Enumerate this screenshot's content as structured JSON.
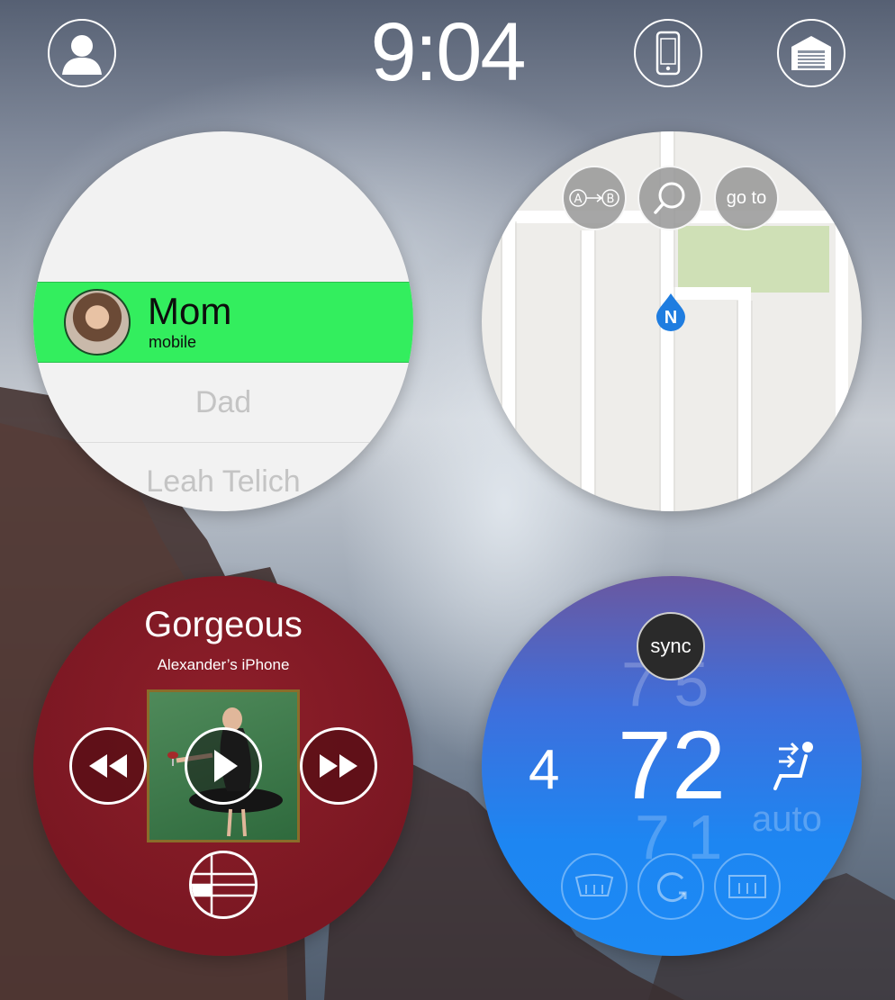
{
  "status": {
    "time": "9:04",
    "icons": [
      "profile-icon",
      "phone-icon",
      "garage-icon"
    ]
  },
  "contacts": {
    "selected": {
      "name": "Mom",
      "type": "mobile"
    },
    "others": [
      "Dad",
      "Leah Telich"
    ]
  },
  "map": {
    "buttons": {
      "route": "route-a-to-b-icon",
      "search": "search-icon",
      "goto_label": "go to"
    },
    "pin_label": "N"
  },
  "music": {
    "title": "Gorgeous",
    "source": "Alexander’s iPhone",
    "controls": [
      "rewind-icon",
      "play-icon",
      "fast-forward-icon",
      "equalizer-icon"
    ]
  },
  "climate": {
    "sync_label": "sync",
    "temperature": "72",
    "fan_speed": "4",
    "ghost_text": "auto",
    "buttons": [
      "windshield-defrost-icon",
      "recirculate-icon",
      "rear-defrost-icon"
    ]
  },
  "colors": {
    "contact_highlight": "#33ee5e",
    "music_bg": "#7a1722",
    "climate_top": "#6a58a0",
    "climate_bottom": "#1c8af5",
    "map_pin": "#1f7de0"
  }
}
